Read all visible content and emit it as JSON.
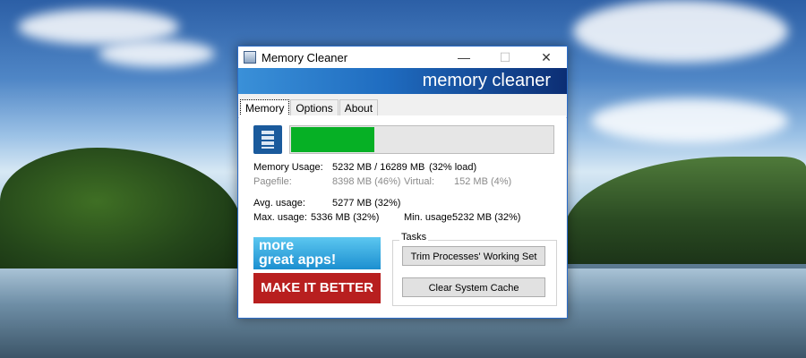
{
  "window": {
    "title": "Memory Cleaner",
    "banner": "memory cleaner",
    "controls": {
      "minimize": "—",
      "maximize": "☐",
      "close": "✕"
    }
  },
  "tabs": [
    {
      "label": "Memory",
      "active": true
    },
    {
      "label": "Options",
      "active": false
    },
    {
      "label": "About",
      "active": false
    }
  ],
  "memory": {
    "progress_fraction": 0.32,
    "usage_label": "Memory Usage:",
    "usage_value": "5232 MB / 16289 MB",
    "usage_load": "(32% load)",
    "pagefile_label": "Pagefile:",
    "pagefile_value": "8398 MB (46%)",
    "virtual_label": "Virtual:",
    "virtual_value": "152 MB (4%)",
    "avg_label": "Avg. usage:",
    "avg_value": "5277 MB (32%)",
    "max_label": "Max. usage:",
    "max_value": "5336 MB (32%)",
    "min_label": "Min. usage:",
    "min_value": "5232 MB (32%)"
  },
  "ads": {
    "more_line1": "more",
    "more_line2": "great apps!",
    "make_better": "MAKE IT BETTER"
  },
  "tasks": {
    "legend": "Tasks",
    "trim_button": "Trim Processes' Working Set",
    "clear_button": "Clear System Cache"
  },
  "colors": {
    "progress": "#06b025",
    "banner_dark": "#0c2e74",
    "ad_red": "#b81f1f"
  }
}
